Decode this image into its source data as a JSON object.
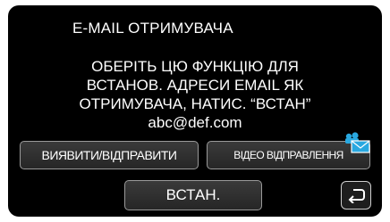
{
  "screen": {
    "title": "E-MAIL ОТРИМУВАЧА",
    "message_lines": [
      "ОБЕРІТЬ ЦЮ ФУНКЦІЮ ДЛЯ",
      "ВСТАНОВ. АДРЕСИ EMAIL ЯК",
      "ОТРИМУВАЧА, НАТИС. “ВСТАН”"
    ],
    "email": "abc@def.com"
  },
  "buttons": {
    "detect_send": "ВИЯВИТИ/ВІДПРАВИТИ",
    "video_send": "ВІДЕО ВІДПРАВЛЕННЯ",
    "set": "ВСТАН."
  },
  "icons": {
    "video_send_icon": "video-mail-icon",
    "back_icon": "return-arrow-icon"
  },
  "colors": {
    "background": "#000000",
    "text": "#ffffff",
    "accent": "#29a8e0"
  }
}
